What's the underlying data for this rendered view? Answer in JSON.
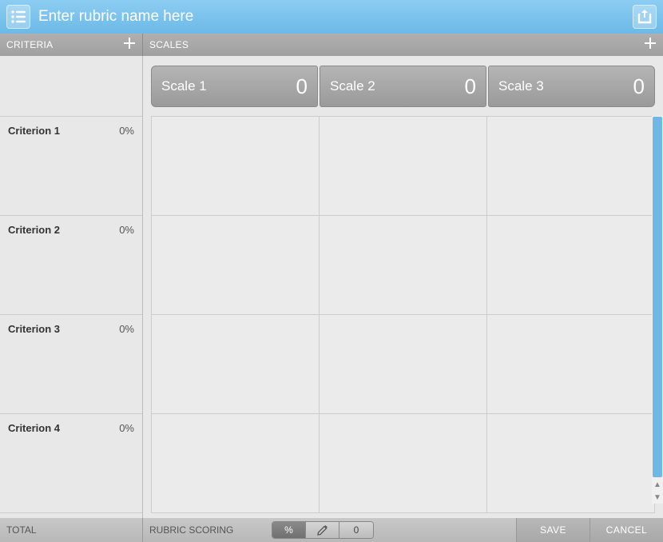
{
  "header": {
    "title_placeholder": "Enter rubric name here"
  },
  "subheader": {
    "criteria_label": "CRITERIA",
    "scales_label": "SCALES"
  },
  "criteria": [
    {
      "name": "Criterion 1",
      "pct": "0%"
    },
    {
      "name": "Criterion 2",
      "pct": "0%"
    },
    {
      "name": "Criterion 3",
      "pct": "0%"
    },
    {
      "name": "Criterion 4",
      "pct": "0%"
    }
  ],
  "scales": [
    {
      "name": "Scale 1",
      "value": "0"
    },
    {
      "name": "Scale 2",
      "value": "0"
    },
    {
      "name": "Scale 3",
      "value": "0"
    }
  ],
  "footer": {
    "total_label": "TOTAL",
    "scoring_label": "RUBRIC SCORING",
    "pct_btn": "%",
    "count_btn": "0",
    "save": "SAVE",
    "cancel": "CANCEL"
  }
}
